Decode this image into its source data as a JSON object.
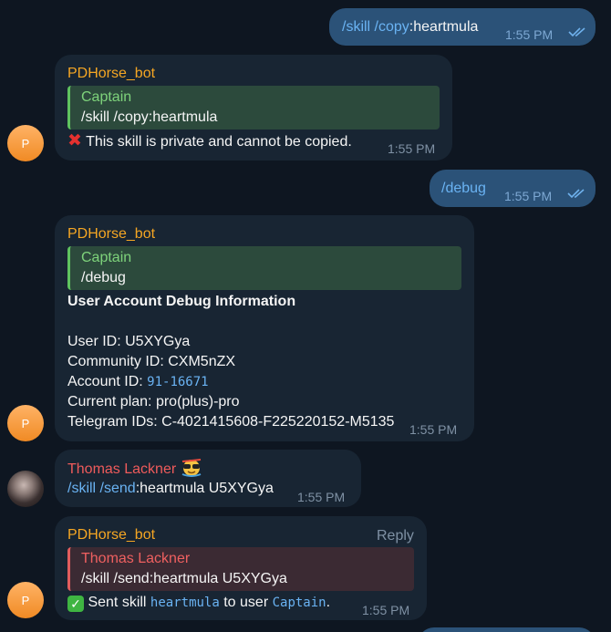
{
  "messages": {
    "m1": {
      "text_cmd": "/skill /copy",
      "text_rest": ":heartmula",
      "time": "1:55 PM"
    },
    "m2": {
      "sender": "PDHorse_bot",
      "quote_name": "Captain",
      "quote_text": "/skill /copy:heartmula",
      "body": "This skill is private and cannot be copied.",
      "time": "1:55 PM",
      "avatar_letter": "P"
    },
    "m3": {
      "text": "/debug",
      "time": "1:55 PM"
    },
    "m4": {
      "sender": "PDHorse_bot",
      "quote_name": "Captain",
      "quote_text": "/debug",
      "heading": "User Account Debug Information",
      "user_id": "User ID: U5XYGya",
      "community_id": "Community ID: CXM5nZX",
      "account_id_label": "Account ID: ",
      "account_id_value": "91-16671",
      "current_plan": "Current plan: pro(plus)-pro",
      "telegram_ids": "Telegram IDs: C-4021415608-F225220152-M5135",
      "time": "1:55 PM",
      "avatar_letter": "P"
    },
    "m5": {
      "sender": "Thomas Lackner",
      "cmd": "/skill /send",
      "rest": ":heartmula U5XYGya",
      "time": "1:55 PM"
    },
    "m6": {
      "sender": "PDHorse_bot",
      "reply_label": "Reply",
      "quote_name": "Thomas Lackner",
      "quote_text": "/skill /send:heartmula U5XYGya",
      "body_pre": "Sent skill ",
      "skill_name": "heartmula",
      "body_mid": " to user ",
      "user_name": "Captain",
      "body_post": ".",
      "time": "1:55 PM",
      "avatar_letter": "P"
    }
  },
  "colors": {
    "background": "#0e1621",
    "outgoing_bubble": "#2b5278",
    "incoming_bubble": "#182533",
    "bot_name": "#f5a623",
    "user_name": "#ef5b5b",
    "link": "#6ab3f3"
  }
}
